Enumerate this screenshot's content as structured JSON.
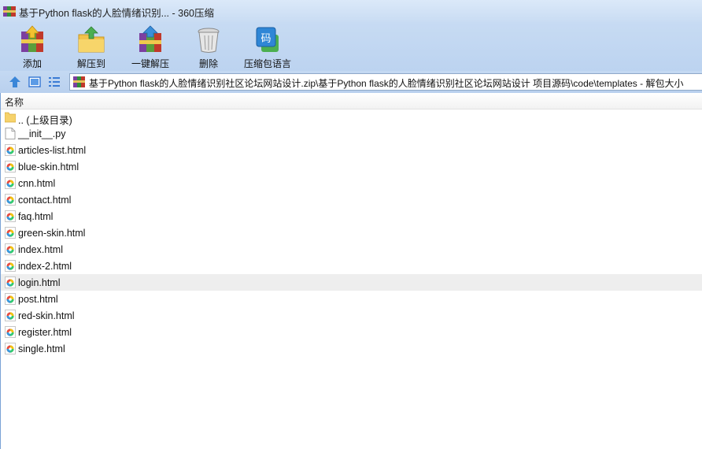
{
  "window": {
    "title": "基于Python flask的人脸情绪识别... - 360压缩",
    "app_icon": "winrar-books-icon"
  },
  "toolbar": {
    "buttons": [
      {
        "label": "添加",
        "icon": "add-archive-icon"
      },
      {
        "label": "解压到",
        "icon": "extract-to-folder-icon"
      },
      {
        "label": "一键解压",
        "icon": "one-click-extract-icon"
      },
      {
        "label": "删除",
        "icon": "delete-trash-icon"
      },
      {
        "label": "压缩包语言",
        "icon": "archive-language-icon"
      }
    ],
    "language_icon_glyph": "码"
  },
  "address": {
    "path": "基于Python flask的人脸情绪识别社区论坛网站设计.zip\\基于Python flask的人脸情绪识别社区论坛网站设计 项目源码\\code\\templates - 解包大小"
  },
  "list": {
    "column_name": "名称",
    "items": [
      {
        "name": ".. (上级目录)",
        "icon": "folder-icon",
        "selected": false
      },
      {
        "name": "__init__.py",
        "icon": "file-icon",
        "selected": false
      },
      {
        "name": "articles-list.html",
        "icon": "html-file-icon",
        "selected": false
      },
      {
        "name": "blue-skin.html",
        "icon": "html-file-icon",
        "selected": false
      },
      {
        "name": "cnn.html",
        "icon": "html-file-icon",
        "selected": false
      },
      {
        "name": "contact.html",
        "icon": "html-file-icon",
        "selected": false
      },
      {
        "name": "faq.html",
        "icon": "html-file-icon",
        "selected": false
      },
      {
        "name": "green-skin.html",
        "icon": "html-file-icon",
        "selected": false
      },
      {
        "name": "index.html",
        "icon": "html-file-icon",
        "selected": false
      },
      {
        "name": "index-2.html",
        "icon": "html-file-icon",
        "selected": false
      },
      {
        "name": "login.html",
        "icon": "html-file-icon",
        "selected": true
      },
      {
        "name": "post.html",
        "icon": "html-file-icon",
        "selected": false
      },
      {
        "name": "red-skin.html",
        "icon": "html-file-icon",
        "selected": false
      },
      {
        "name": "register.html",
        "icon": "html-file-icon",
        "selected": false
      },
      {
        "name": "single.html",
        "icon": "html-file-icon",
        "selected": false
      }
    ]
  },
  "colors": {
    "toolbar_bg": "#bcd3f0",
    "selected_row": "#eeeeee",
    "accent_blue": "#3a7bd5"
  }
}
